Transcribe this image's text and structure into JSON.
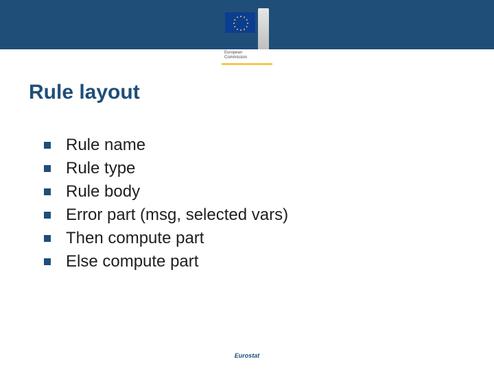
{
  "header": {
    "logo_line1": "European",
    "logo_line2": "Commission"
  },
  "title": "Rule layout",
  "bullets": [
    "Rule name",
    "Rule type",
    "Rule body",
    "Error part (msg, selected vars)",
    "Then compute part",
    "Else compute part"
  ],
  "footer": "Eurostat"
}
